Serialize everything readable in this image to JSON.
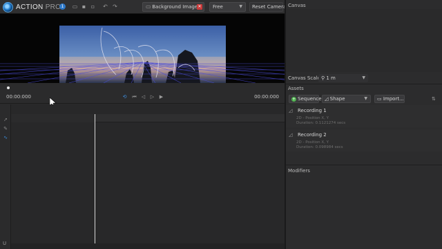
{
  "app": {
    "brand_action": "ACTION",
    "brand_pro": "PRO",
    "brand_badge": "1"
  },
  "toolbar": {
    "icons": [
      "folder-open-icon",
      "save-icon",
      "save-as-icon",
      "undo-icon",
      "redo-icon"
    ],
    "background_image_label": "Background Image...",
    "background_close": "✕",
    "view_mode": "Free",
    "reset_camera_label": "Reset Camera"
  },
  "transport": {
    "time_current": "00:00:000",
    "time_end": "00:00:000",
    "controls": [
      "loop-icon",
      "skip-to-start-icon",
      "step-back-icon",
      "step-forward-icon",
      "play-icon"
    ],
    "accent_color": "#3d8fe0"
  },
  "timeline": {
    "tools": [
      "select-tool-icon",
      "pen-tool-icon",
      "curve-tool-icon"
    ],
    "footer_label": "U"
  },
  "right_panel": {
    "canvas_title": "Canvas",
    "canvas_scale_label": "Canvas Scale:",
    "canvas_scale_value": "1 m",
    "assets_title": "Assets",
    "sequence_label": "Sequence",
    "shape_label": "Shape",
    "import_label": "Import...",
    "recordings": [
      {
        "title": "Recording 1",
        "line1": "2D - Position X, Y",
        "line2": "Duration: 0.1121274 secs"
      },
      {
        "title": "Recording 2",
        "line1": "2D - Position X, Y",
        "line2": "Duration: 0.098984 secs"
      }
    ],
    "modifiers_title": "Modifiers"
  },
  "colors": {
    "panel_bg": "#2c2c2d",
    "viewport_bg": "#050505",
    "grid_line": "#4b4bd8",
    "close_red": "#c93a3a",
    "sequence_green": "#4fb24f"
  }
}
